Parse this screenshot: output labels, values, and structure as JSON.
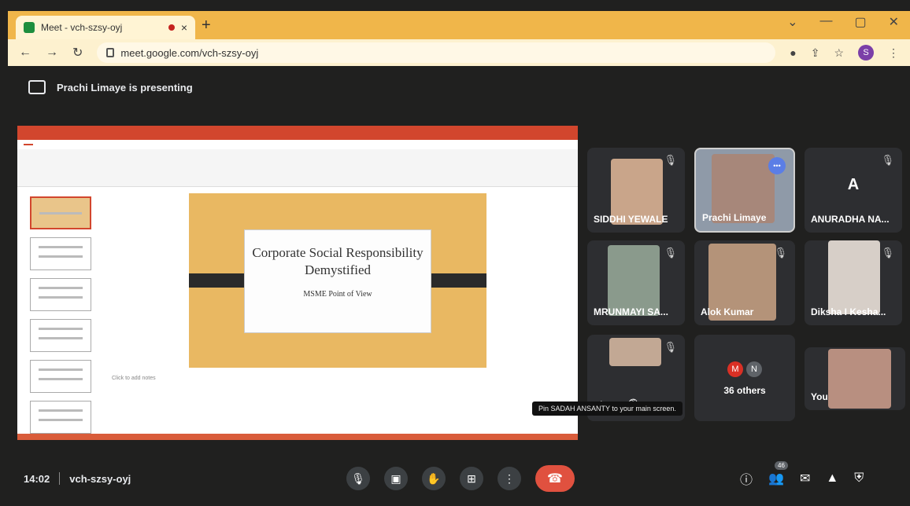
{
  "browser": {
    "tab_title": "Meet - vch-szsy-oyj",
    "tab_close": "×",
    "new_tab": "+",
    "window_controls": [
      "⌄",
      "—",
      "▢",
      "✕"
    ],
    "url": "meet.google.com/vch-szsy-oyj",
    "profile_initial": "S"
  },
  "banner": {
    "text": "Prachi Limaye is presenting"
  },
  "slide": {
    "title": "Corporate Social Responsibility Demystified",
    "subtitle": "MSME Point of View",
    "notes_placeholder": "Click to add notes"
  },
  "participants": [
    {
      "name": "SIDDHI YEWALE",
      "muted": true
    },
    {
      "name": "Prachi Limaye",
      "speaking": true
    },
    {
      "name": "ANURADHA NA...",
      "initial": "A",
      "muted": true
    },
    {
      "name": "MRUNMAYI SA...",
      "muted": true
    },
    {
      "name": "Alok Kumar",
      "muted": true
    },
    {
      "name": "Diksha I Kesha...",
      "muted": true
    },
    {
      "name": "",
      "muted": true
    },
    {
      "name": "You"
    }
  ],
  "others": {
    "initials": [
      "M",
      "N"
    ],
    "label": "36 others"
  },
  "tooltip": "Pin SADAH ANSANTY to your main screen.",
  "meeting": {
    "time": "14:02",
    "code": "vch-szsy-oyj"
  },
  "people_count": "46",
  "colors": {
    "end_call": "#e0513f",
    "tab_strip": "#f0b64a"
  }
}
